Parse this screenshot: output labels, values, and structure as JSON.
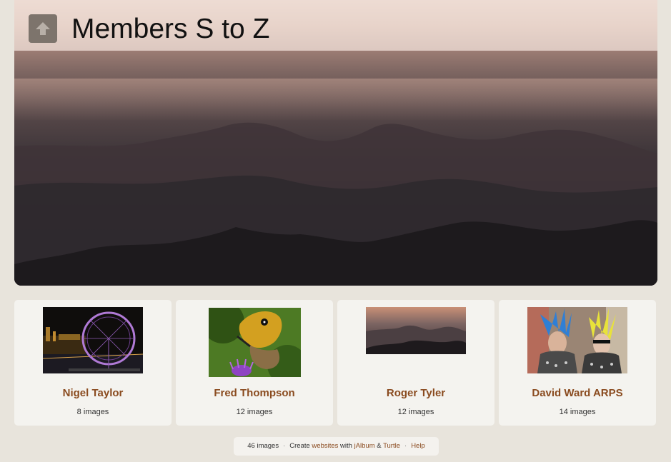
{
  "page": {
    "title": "Members S to Z"
  },
  "nav": {
    "up_icon": "up-arrow-icon"
  },
  "members": [
    {
      "name": "Nigel Taylor",
      "count": "8 images",
      "thumb": "london-eye-night-photo"
    },
    {
      "name": "Fred Thompson",
      "count": "12 images",
      "thumb": "butterfly-on-thistle-photo"
    },
    {
      "name": "Roger Tyler",
      "count": "12 images",
      "thumb": "misty-mountains-photo"
    },
    {
      "name": "David Ward ARPS",
      "count": "14 images",
      "thumb": "mohawk-punks-photo"
    }
  ],
  "footer": {
    "count": "46 images",
    "create": "Create",
    "websites": "websites",
    "with": "with",
    "jalbum": "jAlbum",
    "amp": "&",
    "turtle": "Turtle",
    "help": "Help"
  },
  "colors": {
    "accent": "#8a4b1f",
    "background": "#e8e4dc",
    "card": "#f4f3ef"
  }
}
